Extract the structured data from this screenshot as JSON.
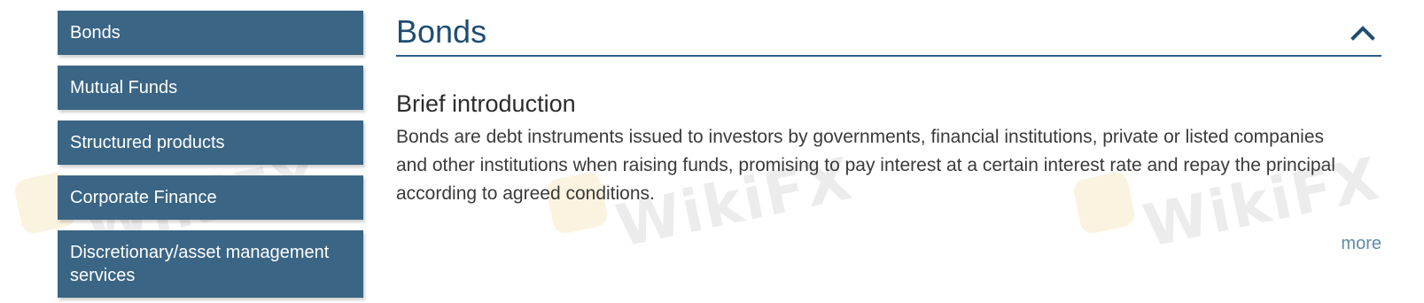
{
  "sidebar": {
    "items": [
      {
        "label": "Bonds"
      },
      {
        "label": "Mutual Funds"
      },
      {
        "label": "Structured products"
      },
      {
        "label": "Corporate Finance"
      },
      {
        "label": "Discretionary/asset management services"
      }
    ]
  },
  "main": {
    "title": "Bonds",
    "toggle_icon": "chevron-up-icon",
    "section": {
      "heading": "Brief introduction",
      "body": "Bonds are debt instruments issued to investors by governments, financial institutions, private or listed companies and other institutions when raising funds, promising to pay interest at a certain interest rate and repay the principal according to agreed conditions.",
      "more_label": "more"
    }
  },
  "watermark": {
    "text": "WikiFX",
    "logo_icon": "wikifx-logo-icon"
  },
  "colors": {
    "sidebar_bg": "#3a6585",
    "title": "#1f4d72",
    "rule": "#2b5f86",
    "link": "#5e89a8",
    "body_text": "#3a3a3a"
  }
}
